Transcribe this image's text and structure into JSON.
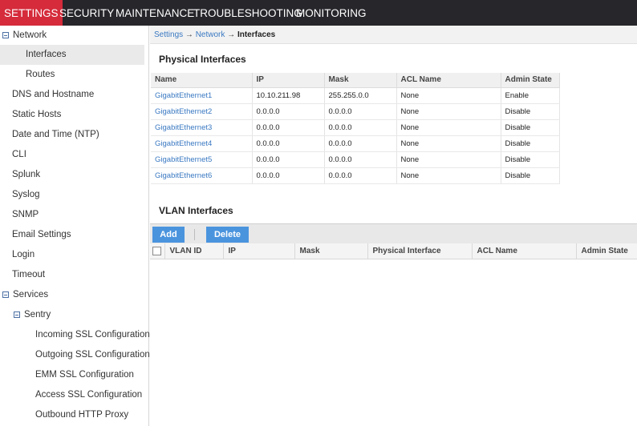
{
  "topnav": {
    "tabs": [
      "SETTINGS",
      "SECURITY",
      "MAINTENANCE",
      "TROUBLESHOOTING",
      "MONITORING"
    ],
    "active": "SETTINGS"
  },
  "sidebar": {
    "items": [
      {
        "label": "Network",
        "expanded": true
      },
      {
        "label": "Interfaces",
        "selected": true
      },
      {
        "label": "Routes"
      },
      {
        "label": "DNS and Hostname"
      },
      {
        "label": "Static Hosts"
      },
      {
        "label": "Date and Time (NTP)"
      },
      {
        "label": "CLI"
      },
      {
        "label": "Splunk"
      },
      {
        "label": "Syslog"
      },
      {
        "label": "SNMP"
      },
      {
        "label": "Email Settings"
      },
      {
        "label": "Login"
      },
      {
        "label": "Timeout"
      },
      {
        "label": "Services",
        "expanded": true
      },
      {
        "label": "Sentry",
        "expanded": true
      },
      {
        "label": "Incoming SSL Configuration"
      },
      {
        "label": "Outgoing SSL Configuration"
      },
      {
        "label": "EMM SSL Configuration"
      },
      {
        "label": "Access SSL Configuration"
      },
      {
        "label": "Outbound HTTP Proxy"
      }
    ]
  },
  "breadcrumb": {
    "items": [
      "Settings",
      "Network",
      "Interfaces"
    ],
    "separator": "→"
  },
  "physical": {
    "title": "Physical Interfaces",
    "columns": [
      "Name",
      "IP",
      "Mask",
      "ACL Name",
      "Admin State"
    ],
    "rows": [
      [
        "GigabitEthernet1",
        "10.10.211.98",
        "255.255.0.0",
        "None",
        "Enable"
      ],
      [
        "GigabitEthernet2",
        "0.0.0.0",
        "0.0.0.0",
        "None",
        "Disable"
      ],
      [
        "GigabitEthernet3",
        "0.0.0.0",
        "0.0.0.0",
        "None",
        "Disable"
      ],
      [
        "GigabitEthernet4",
        "0.0.0.0",
        "0.0.0.0",
        "None",
        "Disable"
      ],
      [
        "GigabitEthernet5",
        "0.0.0.0",
        "0.0.0.0",
        "None",
        "Disable"
      ],
      [
        "GigabitEthernet6",
        "0.0.0.0",
        "0.0.0.0",
        "None",
        "Disable"
      ]
    ]
  },
  "vlan": {
    "title": "VLAN Interfaces",
    "add_label": "Add",
    "delete_label": "Delete",
    "columns": [
      "VLAN ID",
      "IP",
      "Mask",
      "Physical Interface",
      "ACL Name",
      "Admin State"
    ]
  },
  "colors": {
    "active_tab": "#d52b3b",
    "nav_bg": "#26262b",
    "link": "#3a79c2",
    "button": "#4a94de"
  }
}
